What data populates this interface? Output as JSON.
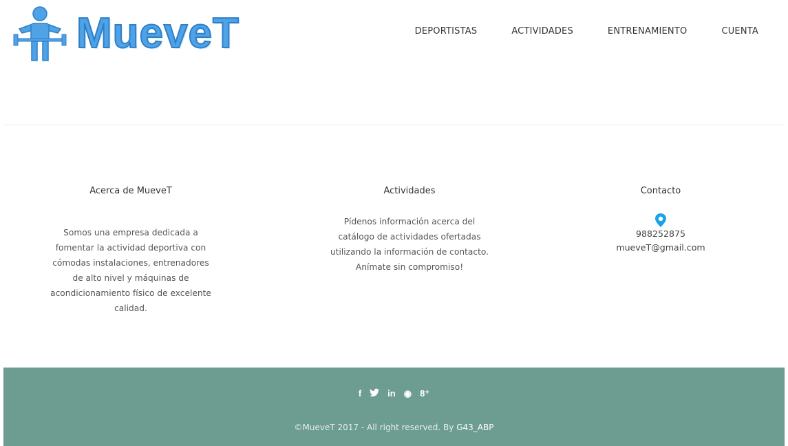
{
  "header": {
    "logo_text": "MueveT",
    "nav": [
      "DEPORTISTAS",
      "ACTIVIDADES",
      "ENTRENAMIENTO",
      "CUENTA"
    ]
  },
  "about": {
    "title": "Acerca de MueveT",
    "text": "Somos una empresa dedicada a fomentar la actividad deportiva con cómodas instalaciones, entrenadores de alto nivel y máquinas de acondicionamiento físico de excelente calidad."
  },
  "activities": {
    "title": "Actividades",
    "text": "Pídenos información acerca del catálogo de actividades ofertadas utilizando la información de contacto. Anímate sin compromiso!"
  },
  "contact": {
    "title": "Contacto",
    "icon": "location-pin-icon",
    "phone": "988252875",
    "email": "mueveT@gmail.com"
  },
  "footer": {
    "social": [
      {
        "name": "facebook-icon",
        "glyph": "f"
      },
      {
        "name": "twitter-icon",
        "glyph": "♥"
      },
      {
        "name": "linkedin-icon",
        "glyph": "in"
      },
      {
        "name": "pinterest-icon",
        "glyph": "◉"
      },
      {
        "name": "googleplus-icon",
        "glyph": "8⁺"
      }
    ],
    "copyright": "©MueveT 2017 - All right reserved. By ",
    "author": "G43_ABP"
  },
  "colors": {
    "brand_blue": "#4fa2e6",
    "footer_bg": "#6d9c91",
    "pin": "#1aa3e8"
  }
}
